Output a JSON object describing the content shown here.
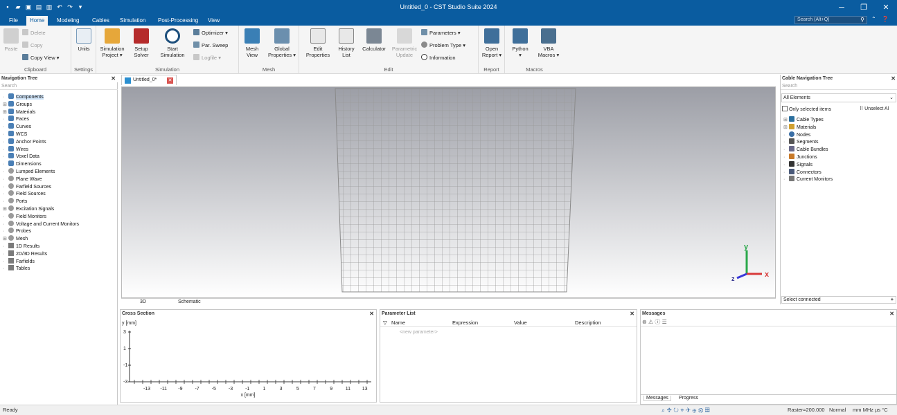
{
  "window": {
    "title": "Untitled_0 - CST Studio Suite 2024"
  },
  "menu": {
    "tabs": [
      "File",
      "Home",
      "Modeling",
      "Cables",
      "Simulation",
      "Post-Processing",
      "View"
    ],
    "search_placeholder": "Search (Alt+Q)"
  },
  "ribbon": {
    "clipboard": {
      "paste": "Paste",
      "delete": "Delete",
      "copy": "Copy",
      "copy_view": "Copy View",
      "group": "Clipboard"
    },
    "settings": {
      "units": "Units",
      "group": "Settings"
    },
    "simulation": {
      "sim_project": "Simulation Project",
      "setup_solver": "Setup Solver",
      "start_simulation": "Start Simulation",
      "optimizer": "Optimizer",
      "par_sweep": "Par. Sweep",
      "logfile": "Logfile",
      "group": "Simulation"
    },
    "mesh": {
      "mesh_view": "Mesh View",
      "global_properties": "Global Properties",
      "group": "Mesh"
    },
    "edit": {
      "edit_properties": "Edit Properties",
      "history_list": "History List",
      "calculator": "Calculator",
      "parametric_update": "Parametric Update",
      "parameters": "Parameters",
      "problem_type": "Problem Type",
      "information": "Information",
      "group": "Edit"
    },
    "report": {
      "open_report": "Open Report",
      "group": "Report"
    },
    "macros": {
      "python": "Python",
      "vba_macros": "VBA Macros",
      "group": "Macros"
    }
  },
  "nav_tree": {
    "title": "Navigation Tree",
    "search": "Search",
    "items": [
      "Components",
      "Groups",
      "Materials",
      "Faces",
      "Curves",
      "WCS",
      "Anchor Points",
      "Wires",
      "Voxel Data",
      "Dimensions",
      "Lumped Elements",
      "Plane Wave",
      "Farfield Sources",
      "Field Sources",
      "Ports",
      "Excitation Signals",
      "Field Monitors",
      "Voltage and Current Monitors",
      "Probes",
      "Mesh",
      "1D Results",
      "2D/3D Results",
      "Farfields",
      "Tables"
    ]
  },
  "document": {
    "tab": "Untitled_0*",
    "view_tabs": [
      "3D",
      "Schematic"
    ]
  },
  "axes": {
    "x": "x",
    "y": "y",
    "z": "z"
  },
  "cable_tree": {
    "title": "Cable Navigation Tree",
    "search": "Search",
    "filter": "All Elements",
    "only_selected": "Only selected items",
    "unselect": "Unselect Al",
    "items": [
      "Cable Types",
      "Materials",
      "Nodes",
      "Segments",
      "Cable Bundles",
      "Junctions",
      "Signals",
      "Connectors",
      "Current Monitors"
    ],
    "footer": "Select connected"
  },
  "cross_section": {
    "title": "Cross Section",
    "ylabel": "y [mm]",
    "xlabel": "x [mm]",
    "yticks": [
      "3",
      "1",
      "-1",
      "-3"
    ],
    "xticks": [
      "-13",
      "-11",
      "-9",
      "-7",
      "-5",
      "-3",
      "-1",
      "1",
      "3",
      "5",
      "7",
      "9",
      "11",
      "13"
    ]
  },
  "parameter_list": {
    "title": "Parameter List",
    "columns": [
      "Name",
      "Expression",
      "Value",
      "Description"
    ],
    "new_row": "<new parameter>"
  },
  "messages": {
    "title": "Messages",
    "tabs": [
      "Messages",
      "Progress"
    ]
  },
  "status": {
    "left": "Ready",
    "raster": "Raster=200.000",
    "mode": "Normal",
    "units": "mm  MHz  µs  °C"
  },
  "colors": {
    "titlebar": "#0a5ca0",
    "ribbon": "#f5f5f5",
    "accent": "#2b8fd0"
  }
}
